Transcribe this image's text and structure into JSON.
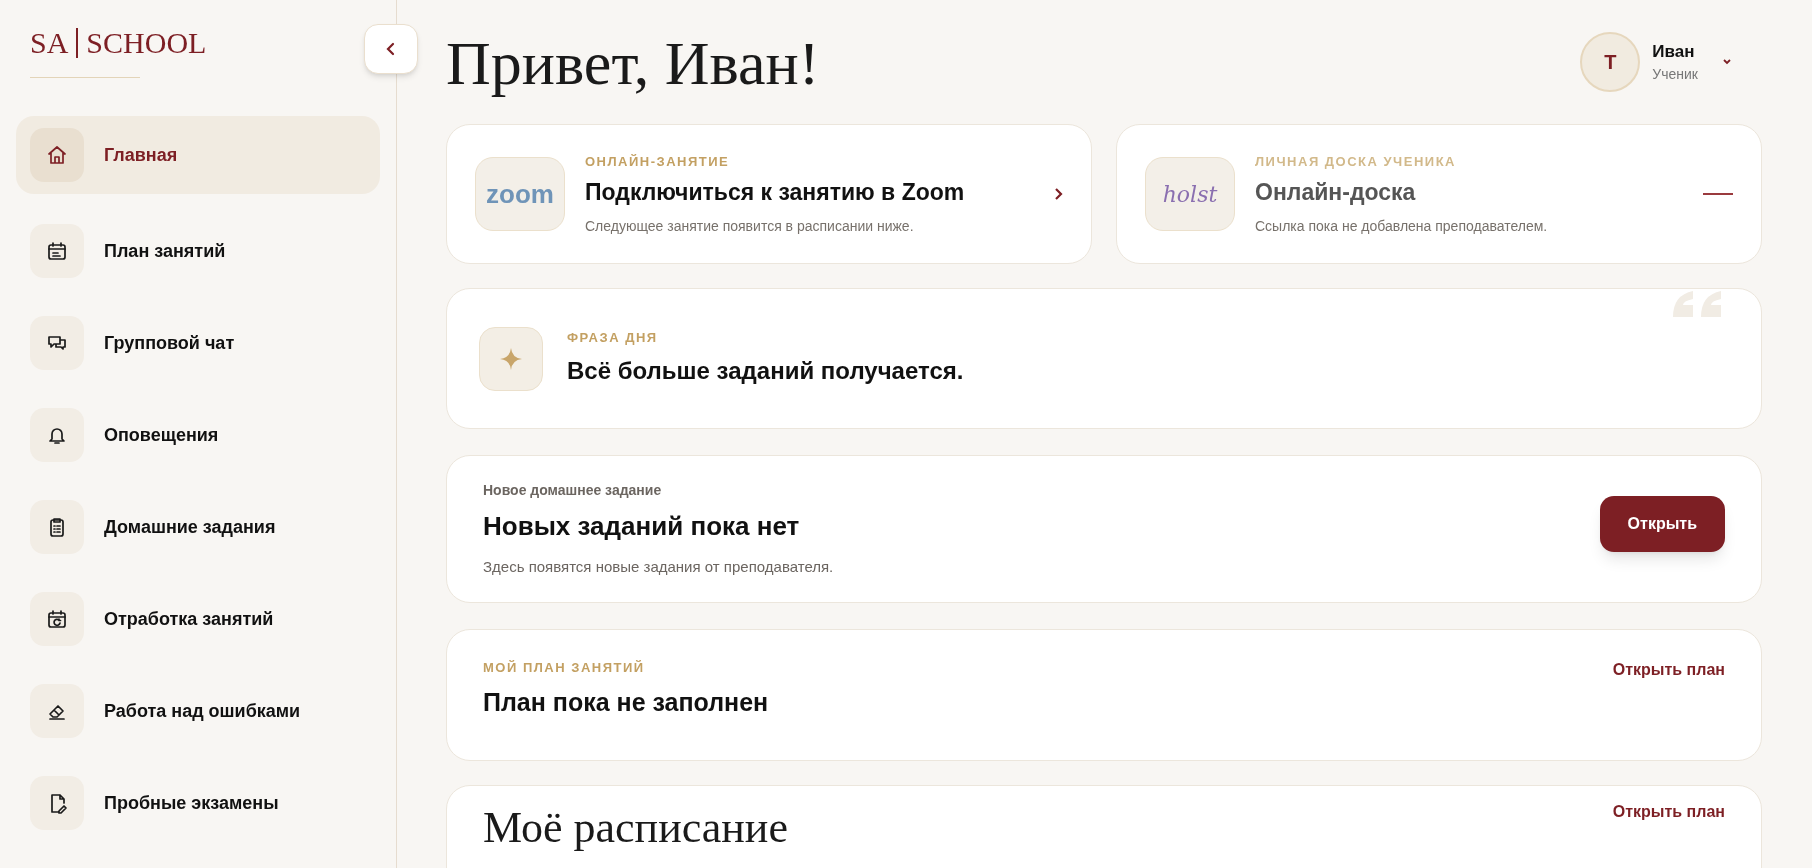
{
  "logo": {
    "brand": "SA",
    "name": "SCHOOL"
  },
  "sidebar": {
    "items": [
      {
        "label": "Главная",
        "kind": "home",
        "selected": true
      },
      {
        "label": "План занятий",
        "kind": "calendar",
        "selected": false
      },
      {
        "label": "Групповой чат",
        "kind": "chat",
        "selected": false
      },
      {
        "label": "Оповещения",
        "kind": "bell",
        "selected": false
      },
      {
        "label": "Домашние задания",
        "kind": "clipboard",
        "selected": false
      },
      {
        "label": "Отработка занятий",
        "kind": "calendar-repeat",
        "selected": false
      },
      {
        "label": "Работа над ошибками",
        "kind": "eraser",
        "selected": false
      },
      {
        "label": "Пробные экзамены",
        "kind": "document",
        "selected": false
      }
    ]
  },
  "greeting": "Привет, Иван!",
  "user": {
    "initial": "Т",
    "name": "Иван",
    "role": "Ученик"
  },
  "link_cards": [
    {
      "kind": "zoom",
      "logo_text": "zoom",
      "eyebrow": "ОНЛАЙН-ЗАНЯТИЕ",
      "title": "Подключиться к занятию в Zoom",
      "subtitle": "Следующее занятие появится в расписании ниже.",
      "available": true
    },
    {
      "kind": "holst",
      "logo_text": "holst",
      "eyebrow": "ЛИЧНАЯ ДОСКА УЧЕНИКА",
      "title": "Онлайн-доска",
      "subtitle": "Ссылка пока не добавлена преподавателем.",
      "available": false
    }
  ],
  "quote": {
    "eyebrow": "ФРАЗА ДНЯ",
    "text": "Всё больше заданий получается."
  },
  "homework": {
    "eyebrow": "Новое домашнее задание",
    "title": "Новых заданий пока нет",
    "subtitle": "Здесь появятся новые задания от преподавателя.",
    "button": "Открыть"
  },
  "plan": {
    "eyebrow": "МОЙ ПЛАН ЗАНЯТИЙ",
    "title": "План пока не заполнен",
    "link": "Открыть план"
  },
  "schedule": {
    "title": "Моё расписание",
    "link": "Открыть план"
  }
}
